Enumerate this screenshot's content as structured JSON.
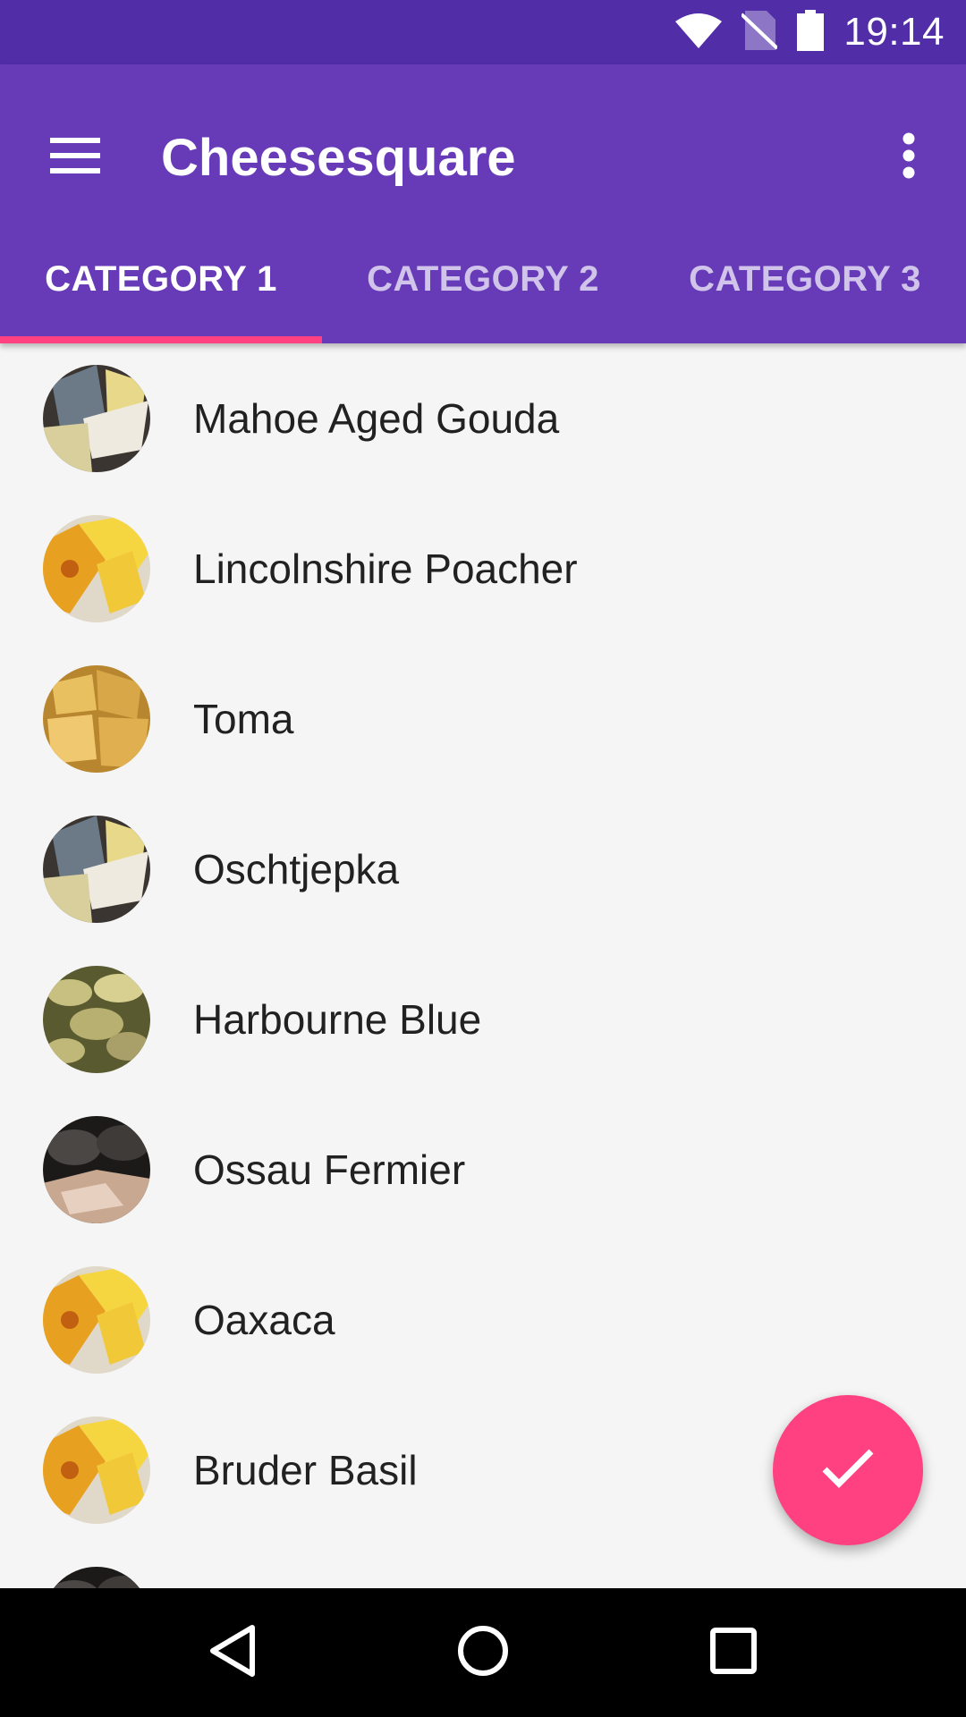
{
  "status_bar": {
    "time": "19:14",
    "icons": [
      "wifi-icon",
      "no-sim-icon",
      "battery-icon"
    ]
  },
  "app_bar": {
    "title": "Cheesesquare",
    "menu_icon": "hamburger-menu-icon",
    "overflow_icon": "more-vert-icon",
    "color": "#673ab7",
    "status_color": "#512da8"
  },
  "tabs": [
    {
      "label": "CATEGORY 1",
      "selected": true
    },
    {
      "label": "CATEGORY 2",
      "selected": false
    },
    {
      "label": "CATEGORY 3",
      "selected": false
    }
  ],
  "list": {
    "items": [
      {
        "name": "Mahoe Aged Gouda",
        "avatar": "cheese-photo-avatar"
      },
      {
        "name": "Lincolnshire Poacher",
        "avatar": "cheese-photo-avatar"
      },
      {
        "name": "Toma",
        "avatar": "cheese-photo-avatar"
      },
      {
        "name": "Oschtjepka",
        "avatar": "cheese-photo-avatar"
      },
      {
        "name": "Harbourne Blue",
        "avatar": "cheese-photo-avatar"
      },
      {
        "name": "Ossau Fermier",
        "avatar": "cheese-photo-avatar"
      },
      {
        "name": "Oaxaca",
        "avatar": "cheese-photo-avatar"
      },
      {
        "name": "Bruder Basil",
        "avatar": "cheese-photo-avatar"
      },
      {
        "name": "",
        "avatar": "cheese-photo-avatar"
      }
    ]
  },
  "fab": {
    "icon": "check-icon",
    "color": "#ff4081"
  },
  "nav_bar": {
    "icons": [
      "back-icon",
      "home-icon",
      "recents-icon"
    ]
  }
}
